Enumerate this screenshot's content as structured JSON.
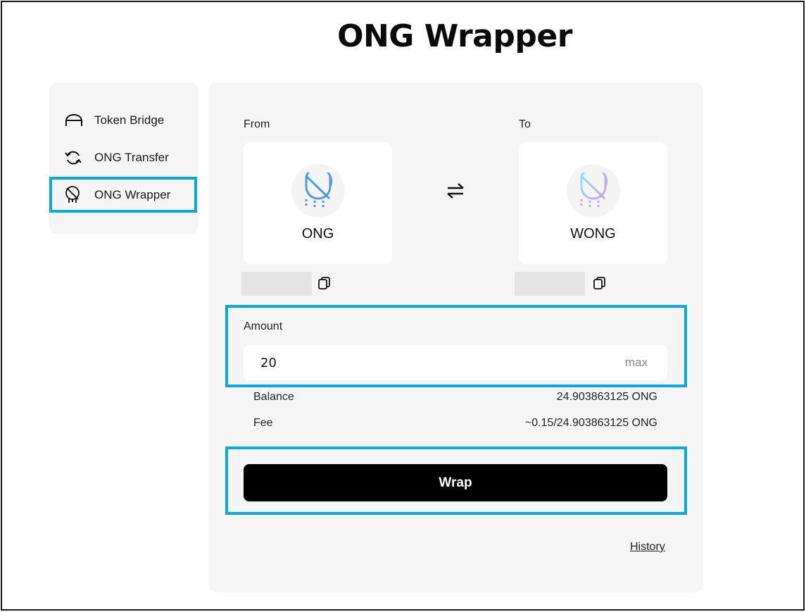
{
  "header": {
    "title": "ONG Wrapper"
  },
  "sidebar": {
    "items": [
      {
        "label": "Token Bridge",
        "icon": "bridge-icon"
      },
      {
        "label": "ONG Transfer",
        "icon": "transfer-icon"
      },
      {
        "label": "ONG Wrapper",
        "icon": "wrapper-icon",
        "selected": true
      }
    ]
  },
  "wrapper": {
    "from_label": "From",
    "to_label": "To",
    "from_token": {
      "name": "ONG",
      "icon": "ong-logo-icon"
    },
    "to_token": {
      "name": "WONG",
      "icon": "wong-logo-icon"
    },
    "swap_icon": "swap-arrows-icon",
    "copy_icon": "copy-icon",
    "amount_label": "Amount",
    "amount_value": "20",
    "max_label": "max",
    "balance_label": "Balance",
    "balance_value": "24.903863125 ONG",
    "fee_label": "Fee",
    "fee_value": "~0.15/24.903863125 ONG",
    "wrap_button": "Wrap",
    "history_link": "History"
  },
  "colors": {
    "highlight": "#0aa9dd",
    "panel_bg": "#f5f5f5",
    "button_bg": "#000000",
    "ong_accent": "#4a9be8",
    "wong_accent_start": "#8fe3ef",
    "wong_accent_end": "#c6a3f0"
  }
}
